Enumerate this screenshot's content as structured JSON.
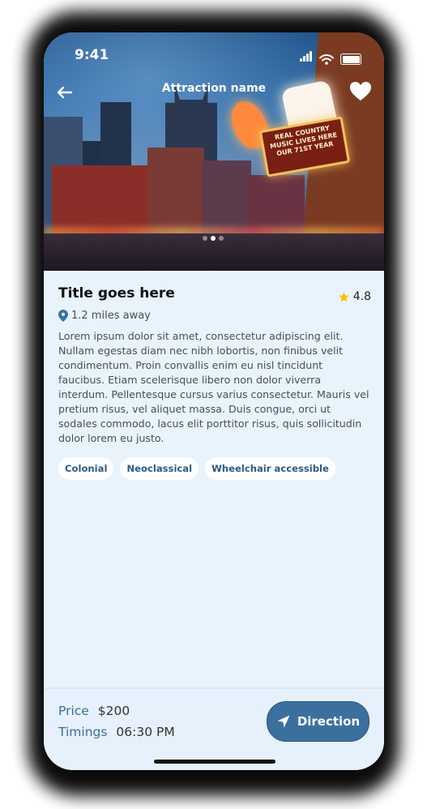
{
  "status_bar": {
    "time": "9:41"
  },
  "header": {
    "title": "Attraction name"
  },
  "carousel": {
    "count": 3,
    "active_index": 1
  },
  "hero_sign_text": "REAL COUNTRY MUSIC LIVES HERE OUR 71ST YEAR",
  "details": {
    "title": "Title goes here",
    "rating": "4.8",
    "distance": "1.2 miles away",
    "description": "Lorem ipsum dolor sit amet, consectetur adipiscing elit. Nullam egestas diam nec nibh lobortis, non finibus velit condimentum. Proin convallis enim eu nisl tincidunt faucibus. Etiam scelerisque libero non dolor viverra interdum. Pellentesque cursus varius consectetur. Mauris vel pretium risus, vel aliquet massa. Duis congue, orci ut sodales commodo, lacus elit porttitor risus, quis sollicitudin dolor lorem eu justo.",
    "tags": [
      "Colonial",
      "Neoclassical",
      "Wheelchair accessible"
    ]
  },
  "footer": {
    "price_label": "Price",
    "price_value": "$200",
    "timings_label": "Timings",
    "timings_value": "06:30 PM",
    "direction_label": "Direction"
  },
  "colors": {
    "accent": "#3b709e",
    "background": "#e8f3fc",
    "star": "#f5c400"
  }
}
